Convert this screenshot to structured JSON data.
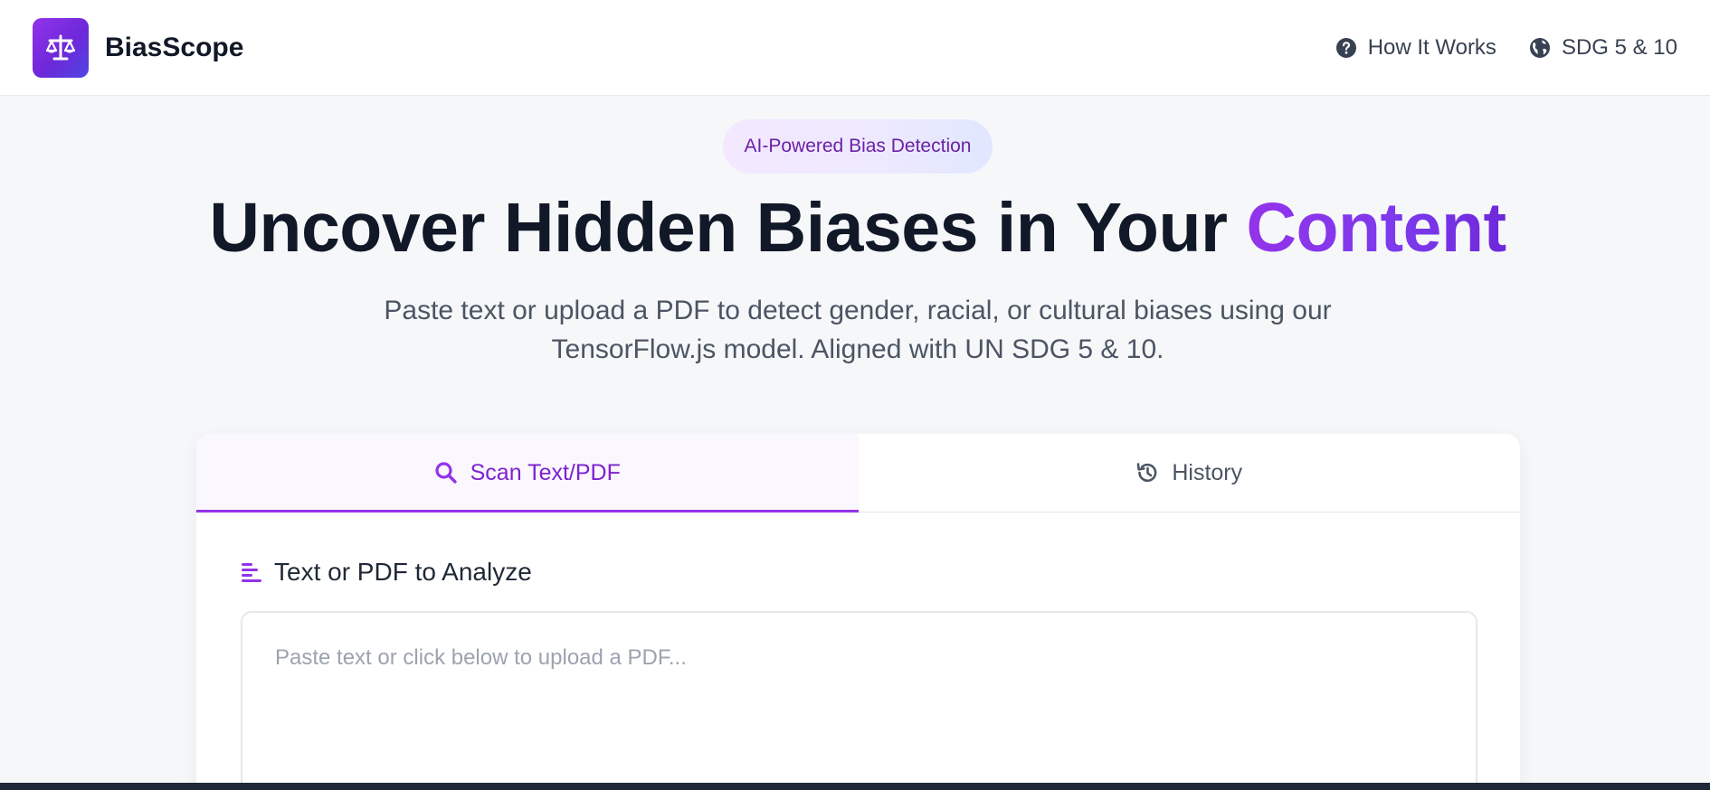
{
  "header": {
    "brand_name": "BiasScope",
    "nav": [
      {
        "label": "How It Works",
        "icon": "question-circle-icon"
      },
      {
        "label": "SDG 5 & 10",
        "icon": "globe-icon"
      }
    ]
  },
  "hero": {
    "badge": "AI-Powered Bias Detection",
    "title_main": "Uncover Hidden Biases in Your ",
    "title_accent": "Content",
    "subtitle_line1": "Paste text or upload a PDF to detect gender, racial, or cultural biases using our",
    "subtitle_line2": "TensorFlow.js model. Aligned with UN SDG 5 & 10."
  },
  "card": {
    "tabs": [
      {
        "label": "Scan Text/PDF",
        "icon": "search-icon",
        "active": true
      },
      {
        "label": "History",
        "icon": "history-icon",
        "active": false
      }
    ],
    "section_label": "Text or PDF to Analyze",
    "section_icon": "align-left-icon",
    "textarea_placeholder": "Paste text or click below to upload a PDF...",
    "textarea_value": ""
  },
  "colors": {
    "accent": "#9333ea",
    "accent_dark": "#7e22ce",
    "heading": "#111827",
    "body_text": "#4b5563"
  }
}
